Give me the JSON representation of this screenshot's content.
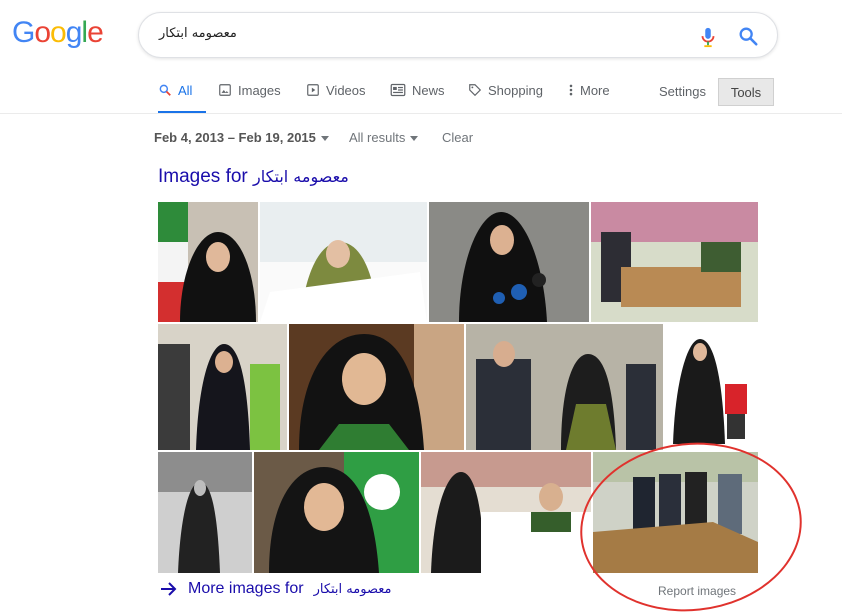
{
  "logo": {
    "letters": [
      "G",
      "o",
      "o",
      "g",
      "l",
      "e"
    ],
    "colors": [
      "#4285F4",
      "#EA4335",
      "#FBBC05",
      "#4285F4",
      "#34A853",
      "#EA4335"
    ]
  },
  "search": {
    "query": "معصومه ابتکار",
    "mic_icon": "microphone-icon",
    "search_icon": "magnifier-icon"
  },
  "tabs": [
    {
      "label": "All",
      "icon": "search-icon",
      "active": true
    },
    {
      "label": "Images",
      "icon": "image-icon",
      "active": false
    },
    {
      "label": "Videos",
      "icon": "play-icon",
      "active": false
    },
    {
      "label": "News",
      "icon": "newspaper-icon",
      "active": false
    },
    {
      "label": "Shopping",
      "icon": "tag-icon",
      "active": false
    },
    {
      "label": "More",
      "icon": "vertical-dots-icon",
      "active": false
    }
  ],
  "settings_label": "Settings",
  "tools_label": "Tools",
  "filters": {
    "date_range": "Feb 4, 2013 – Feb 19, 2015",
    "results": "All results",
    "clear": "Clear"
  },
  "images_heading": {
    "prefix": "Images for",
    "query": "معصومه ابتکار"
  },
  "more_images": {
    "prefix": "More images for",
    "query": "معصومه ابتکار",
    "arrow_icon": "arrow-right-icon"
  },
  "report_images": "Report images",
  "colors": {
    "accent": "#1a73e8",
    "link": "#1a0dab",
    "annotation": "#e0322d"
  }
}
